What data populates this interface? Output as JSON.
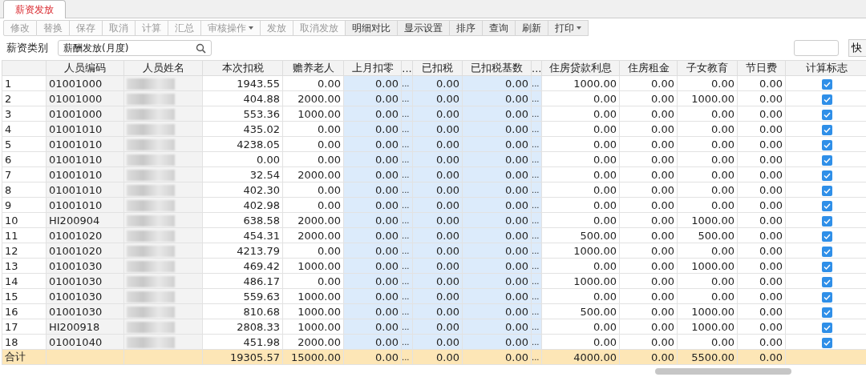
{
  "tab": {
    "label": "薪资发放",
    "selected": true
  },
  "toolbar": [
    {
      "label": "修改",
      "disabled": true
    },
    {
      "label": "替换",
      "disabled": true
    },
    {
      "label": "保存",
      "disabled": true
    },
    {
      "label": "取消",
      "disabled": true
    },
    {
      "label": "计算",
      "disabled": true
    },
    {
      "label": "汇总",
      "disabled": true
    },
    {
      "label": "审核操作",
      "disabled": true,
      "dropdown": true
    },
    {
      "label": "发放",
      "disabled": true
    },
    {
      "label": "取消发放",
      "disabled": true
    },
    {
      "label": "明细对比",
      "disabled": false
    },
    {
      "label": "显示设置",
      "disabled": false
    },
    {
      "label": "排序",
      "disabled": false
    },
    {
      "label": "查询",
      "disabled": false
    },
    {
      "label": "刷新",
      "disabled": false
    },
    {
      "label": "打印",
      "disabled": false,
      "dropdown": true
    }
  ],
  "filter": {
    "label": "薪资类别",
    "value": "薪酬发放(月度)"
  },
  "quick_search": {
    "button": "快"
  },
  "table": {
    "fixed_columns": [
      {
        "kind": "index"
      },
      {
        "label": "人员编码",
        "kind": "code"
      },
      {
        "label": "人员姓名",
        "kind": "name"
      }
    ],
    "columns": [
      {
        "label": "本次扣税",
        "kind": "num"
      },
      {
        "label": "赡养老人",
        "kind": "num"
      },
      {
        "label": "上月扣零",
        "kind": "locked"
      },
      {
        "label": "...",
        "kind": "more"
      },
      {
        "label": "已扣税",
        "kind": "locked"
      },
      {
        "label": "已扣税基数",
        "kind": "locked"
      },
      {
        "label": "...",
        "kind": "more"
      },
      {
        "label": "住房贷款利息",
        "kind": "num"
      },
      {
        "label": "住房租金",
        "kind": "num"
      },
      {
        "label": "子女教育",
        "kind": "num"
      },
      {
        "label": "节日费",
        "kind": "num"
      },
      {
        "label": "计算标志",
        "kind": "flag"
      }
    ],
    "rows": [
      {
        "index": "1",
        "code": "01001000",
        "cells": [
          "1943.55",
          "0.00",
          "0.00",
          "...",
          "0.00",
          "0.00",
          "...",
          "1000.00",
          "0.00",
          "0.00",
          "0.00"
        ],
        "checked": true
      },
      {
        "index": "2",
        "code": "01001000",
        "cells": [
          "404.88",
          "2000.00",
          "0.00",
          "...",
          "0.00",
          "0.00",
          "...",
          "0.00",
          "0.00",
          "1000.00",
          "0.00"
        ],
        "checked": true
      },
      {
        "index": "3",
        "code": "01001000",
        "cells": [
          "553.36",
          "1000.00",
          "0.00",
          "...",
          "0.00",
          "0.00",
          "...",
          "0.00",
          "0.00",
          "0.00",
          "0.00"
        ],
        "checked": true
      },
      {
        "index": "4",
        "code": "01001010",
        "cells": [
          "435.02",
          "0.00",
          "0.00",
          "...",
          "0.00",
          "0.00",
          "...",
          "0.00",
          "0.00",
          "0.00",
          "0.00"
        ],
        "checked": true
      },
      {
        "index": "5",
        "code": "01001010",
        "cells": [
          "4238.05",
          "0.00",
          "0.00",
          "...",
          "0.00",
          "0.00",
          "...",
          "0.00",
          "0.00",
          "0.00",
          "0.00"
        ],
        "checked": true
      },
      {
        "index": "6",
        "code": "01001010",
        "cells": [
          "0.00",
          "0.00",
          "0.00",
          "...",
          "0.00",
          "0.00",
          "...",
          "0.00",
          "0.00",
          "0.00",
          "0.00"
        ],
        "checked": true
      },
      {
        "index": "7",
        "code": "01001010",
        "cells": [
          "32.54",
          "2000.00",
          "0.00",
          "...",
          "0.00",
          "0.00",
          "...",
          "0.00",
          "0.00",
          "0.00",
          "0.00"
        ],
        "checked": true
      },
      {
        "index": "8",
        "code": "01001010",
        "cells": [
          "402.30",
          "0.00",
          "0.00",
          "...",
          "0.00",
          "0.00",
          "...",
          "0.00",
          "0.00",
          "0.00",
          "0.00"
        ],
        "checked": true
      },
      {
        "index": "9",
        "code": "01001010",
        "cells": [
          "402.98",
          "0.00",
          "0.00",
          "...",
          "0.00",
          "0.00",
          "...",
          "0.00",
          "0.00",
          "0.00",
          "0.00"
        ],
        "checked": true
      },
      {
        "index": "10",
        "code": "HI200904",
        "cells": [
          "638.58",
          "2000.00",
          "0.00",
          "...",
          "0.00",
          "0.00",
          "...",
          "0.00",
          "0.00",
          "1000.00",
          "0.00"
        ],
        "checked": true
      },
      {
        "index": "11",
        "code": "01001020",
        "cells": [
          "454.31",
          "2000.00",
          "0.00",
          "...",
          "0.00",
          "0.00",
          "...",
          "500.00",
          "0.00",
          "500.00",
          "0.00"
        ],
        "checked": true
      },
      {
        "index": "12",
        "code": "01001020",
        "cells": [
          "4213.79",
          "0.00",
          "0.00",
          "...",
          "0.00",
          "0.00",
          "...",
          "1000.00",
          "0.00",
          "0.00",
          "0.00"
        ],
        "checked": true
      },
      {
        "index": "13",
        "code": "01001030",
        "cells": [
          "469.42",
          "1000.00",
          "0.00",
          "...",
          "0.00",
          "0.00",
          "...",
          "0.00",
          "0.00",
          "1000.00",
          "0.00"
        ],
        "checked": true
      },
      {
        "index": "14",
        "code": "01001030",
        "cells": [
          "486.17",
          "0.00",
          "0.00",
          "...",
          "0.00",
          "0.00",
          "...",
          "1000.00",
          "0.00",
          "0.00",
          "0.00"
        ],
        "checked": true
      },
      {
        "index": "15",
        "code": "01001030",
        "cells": [
          "559.63",
          "1000.00",
          "0.00",
          "...",
          "0.00",
          "0.00",
          "...",
          "0.00",
          "0.00",
          "0.00",
          "0.00"
        ],
        "checked": true
      },
      {
        "index": "16",
        "code": "01001030",
        "cells": [
          "810.68",
          "1000.00",
          "0.00",
          "...",
          "0.00",
          "0.00",
          "...",
          "500.00",
          "0.00",
          "1000.00",
          "0.00"
        ],
        "checked": true
      },
      {
        "index": "17",
        "code": "HI200918",
        "cells": [
          "2808.33",
          "1000.00",
          "0.00",
          "...",
          "0.00",
          "0.00",
          "...",
          "0.00",
          "0.00",
          "1000.00",
          "0.00"
        ],
        "checked": true
      },
      {
        "index": "18",
        "code": "01001040",
        "cells": [
          "451.98",
          "2000.00",
          "0.00",
          "...",
          "0.00",
          "0.00",
          "...",
          "0.00",
          "0.00",
          "0.00",
          "0.00"
        ],
        "checked": true
      }
    ],
    "total": {
      "label": "合计",
      "cells": [
        "19305.57",
        "15000.00",
        "0.00",
        "...",
        "0.00",
        "0.00",
        "...",
        "4000.00",
        "0.00",
        "5500.00",
        "0.00"
      ]
    }
  }
}
